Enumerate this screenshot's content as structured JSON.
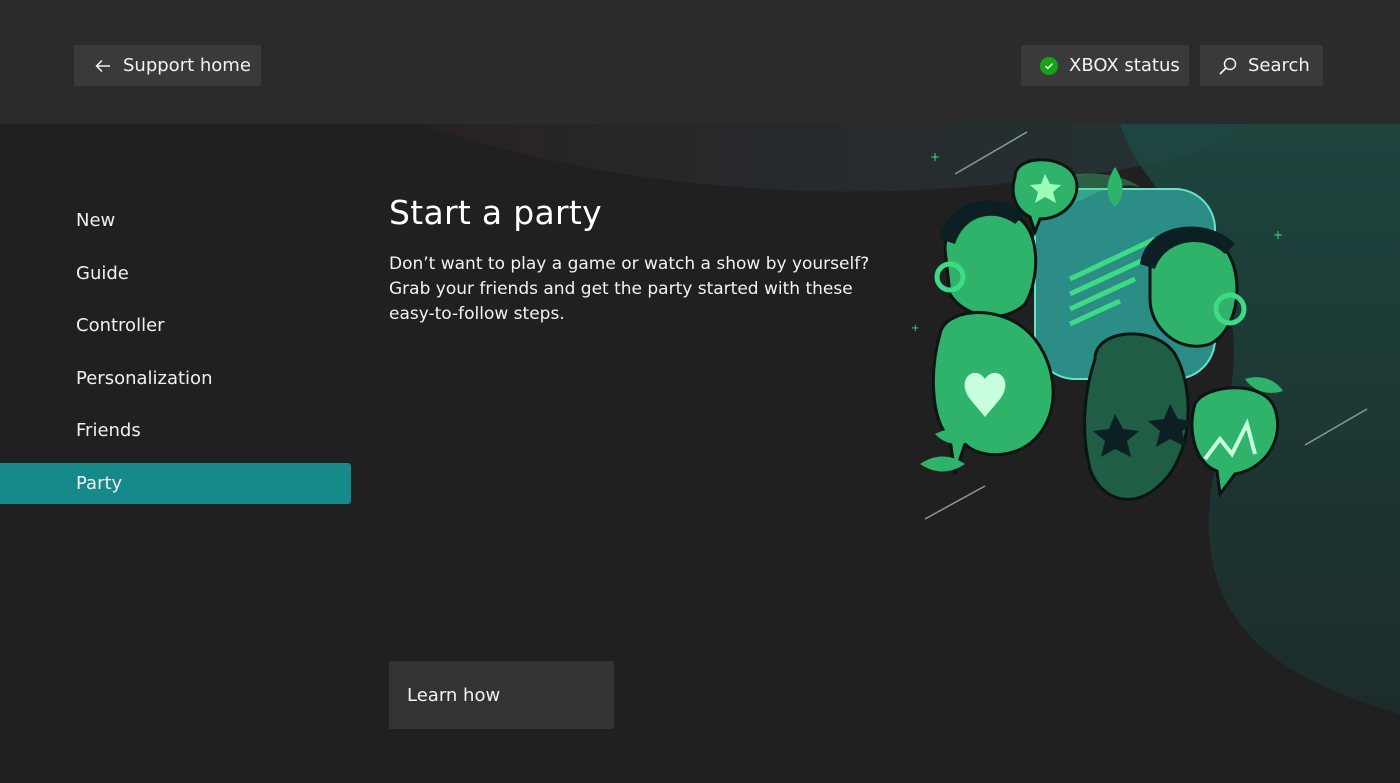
{
  "header": {
    "back_label": "Support home",
    "status_label": "XBOX status",
    "search_label": "Search"
  },
  "nav": {
    "items": [
      {
        "label": "New"
      },
      {
        "label": "Guide"
      },
      {
        "label": "Controller"
      },
      {
        "label": "Personalization"
      },
      {
        "label": "Friends"
      },
      {
        "label": "Party",
        "active": true
      }
    ]
  },
  "content": {
    "title": "Start a party",
    "description": "Don’t want to play a game or watch a show by yourself? Grab your friends and get the party started with these easy-to-follow steps.",
    "cta_label": "Learn how"
  },
  "icons": {
    "back": "arrow-left-icon",
    "status": "checkmark-circle-icon",
    "search": "search-icon"
  },
  "colors": {
    "accent": "#168a8a",
    "status_ok": "#17a318",
    "illustration_green": "#3ddc84"
  }
}
